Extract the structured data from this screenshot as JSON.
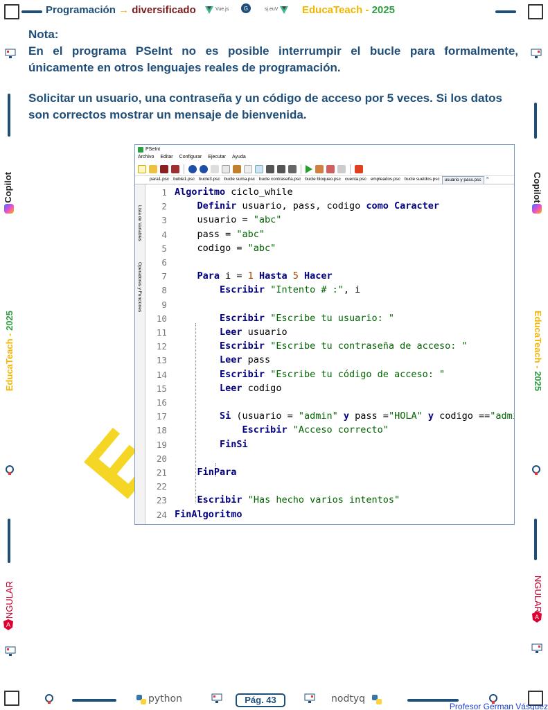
{
  "header": {
    "left_text": "Programación",
    "arrow": "→",
    "right_text": "diversificado",
    "vue_text": "Vue.js",
    "vue_mirror_text": "sį.euV",
    "brand_a": "EducaTeach - ",
    "brand_b": "2025"
  },
  "note": {
    "title": "Nota:",
    "text": "En el programa PSeInt no es posible interrumpir el bucle para formalmente, únicamente en otros lenguajes reales de programación."
  },
  "task": {
    "text": "Solicitar un usuario, una contraseña y un código de acceso por 5 veces. Si los datos son correctos mostrar un mensaje de bienvenida."
  },
  "side": {
    "copilot": "Copilot",
    "brand": "EducaTeach - ",
    "brand_year": "2025",
    "angular": "NGULAR"
  },
  "pseint": {
    "title": "PSeInt",
    "menu": [
      "Archivo",
      "Editar",
      "Configurar",
      "Ejecutar",
      "Ayuda"
    ],
    "tabs": [
      "para1.psc",
      "buble1.psc",
      "bucle3.psc",
      "bucle suma.psc",
      "bucle contraseña.psc",
      "bucle bloqueo.psc",
      "cuenta.psc",
      "empleados.psc",
      "bucle sueldos.psc",
      "usuario y pass.psc"
    ],
    "tab_close": "×",
    "side_tabs": [
      "Lista de Variables",
      "Operadores y Funciones"
    ],
    "code": [
      {
        "n": "1",
        "parts": [
          {
            "t": "kw",
            "v": "Algoritmo"
          },
          {
            "t": "pl",
            "v": " ciclo_while"
          }
        ]
      },
      {
        "n": "2",
        "parts": [
          {
            "t": "pl",
            "v": "    "
          },
          {
            "t": "kw",
            "v": "Definir"
          },
          {
            "t": "pl",
            "v": " usuario, pass, codigo "
          },
          {
            "t": "kw",
            "v": "como"
          },
          {
            "t": "pl",
            "v": " "
          },
          {
            "t": "kw",
            "v": "Caracter"
          }
        ]
      },
      {
        "n": "3",
        "parts": [
          {
            "t": "pl",
            "v": "    usuario = "
          },
          {
            "t": "str",
            "v": "\"abc\""
          }
        ]
      },
      {
        "n": "4",
        "parts": [
          {
            "t": "pl",
            "v": "    pass = "
          },
          {
            "t": "str",
            "v": "\"abc\""
          }
        ]
      },
      {
        "n": "5",
        "parts": [
          {
            "t": "pl",
            "v": "    codigo = "
          },
          {
            "t": "str",
            "v": "\"abc\""
          }
        ]
      },
      {
        "n": "6",
        "parts": []
      },
      {
        "n": "7",
        "parts": [
          {
            "t": "pl",
            "v": "    "
          },
          {
            "t": "kw",
            "v": "Para"
          },
          {
            "t": "pl",
            "v": " i = "
          },
          {
            "t": "num",
            "v": "1"
          },
          {
            "t": "pl",
            "v": " "
          },
          {
            "t": "kw",
            "v": "Hasta"
          },
          {
            "t": "pl",
            "v": " "
          },
          {
            "t": "num",
            "v": "5"
          },
          {
            "t": "pl",
            "v": " "
          },
          {
            "t": "kw",
            "v": "Hacer"
          }
        ]
      },
      {
        "n": "8",
        "parts": [
          {
            "t": "pl",
            "v": "        "
          },
          {
            "t": "kw",
            "v": "Escribir"
          },
          {
            "t": "pl",
            "v": " "
          },
          {
            "t": "str",
            "v": "\"Intento # :\""
          },
          {
            "t": "pl",
            "v": ", i"
          }
        ]
      },
      {
        "n": "9",
        "parts": []
      },
      {
        "n": "10",
        "parts": [
          {
            "t": "pl",
            "v": "        "
          },
          {
            "t": "kw",
            "v": "Escribir"
          },
          {
            "t": "pl",
            "v": " "
          },
          {
            "t": "str",
            "v": "\"Escribe tu usuario: \""
          }
        ]
      },
      {
        "n": "11",
        "parts": [
          {
            "t": "pl",
            "v": "        "
          },
          {
            "t": "kw",
            "v": "Leer"
          },
          {
            "t": "pl",
            "v": " usuario"
          }
        ]
      },
      {
        "n": "12",
        "parts": [
          {
            "t": "pl",
            "v": "        "
          },
          {
            "t": "kw",
            "v": "Escribir"
          },
          {
            "t": "pl",
            "v": " "
          },
          {
            "t": "str",
            "v": "\"Escribe tu contraseña de acceso: \""
          }
        ]
      },
      {
        "n": "13",
        "parts": [
          {
            "t": "pl",
            "v": "        "
          },
          {
            "t": "kw",
            "v": "Leer"
          },
          {
            "t": "pl",
            "v": " pass"
          }
        ]
      },
      {
        "n": "14",
        "parts": [
          {
            "t": "pl",
            "v": "        "
          },
          {
            "t": "kw",
            "v": "Escribir"
          },
          {
            "t": "pl",
            "v": " "
          },
          {
            "t": "str",
            "v": "\"Escribe tu código de acceso: \""
          }
        ]
      },
      {
        "n": "15",
        "parts": [
          {
            "t": "pl",
            "v": "        "
          },
          {
            "t": "kw",
            "v": "Leer"
          },
          {
            "t": "pl",
            "v": " codigo"
          }
        ]
      },
      {
        "n": "16",
        "parts": []
      },
      {
        "n": "17",
        "parts": [
          {
            "t": "pl",
            "v": "        "
          },
          {
            "t": "kw",
            "v": "Si"
          },
          {
            "t": "pl",
            "v": " (usuario = "
          },
          {
            "t": "str",
            "v": "\"admin\""
          },
          {
            "t": "pl",
            "v": " "
          },
          {
            "t": "kw",
            "v": "y"
          },
          {
            "t": "pl",
            "v": " pass ="
          },
          {
            "t": "str",
            "v": "\"HOLA\""
          },
          {
            "t": "pl",
            "v": " "
          },
          {
            "t": "kw",
            "v": "y"
          },
          {
            "t": "pl",
            "v": " codigo =="
          },
          {
            "t": "str",
            "v": "\"admin\""
          },
          {
            "t": "pl",
            "v": ")"
          }
        ]
      },
      {
        "n": "18",
        "parts": [
          {
            "t": "pl",
            "v": "            "
          },
          {
            "t": "kw",
            "v": "Escribir"
          },
          {
            "t": "pl",
            "v": " "
          },
          {
            "t": "str",
            "v": "\"Acceso correcto\""
          }
        ]
      },
      {
        "n": "19",
        "parts": [
          {
            "t": "pl",
            "v": "        "
          },
          {
            "t": "kw",
            "v": "FinSi"
          }
        ]
      },
      {
        "n": "20",
        "parts": []
      },
      {
        "n": "21",
        "parts": [
          {
            "t": "pl",
            "v": "    "
          },
          {
            "t": "kw",
            "v": "FinPara"
          }
        ]
      },
      {
        "n": "22",
        "parts": []
      },
      {
        "n": "23",
        "parts": [
          {
            "t": "pl",
            "v": "    "
          },
          {
            "t": "kw",
            "v": "Escribir"
          },
          {
            "t": "pl",
            "v": " "
          },
          {
            "t": "str",
            "v": "\"Has hecho varios intentos\""
          }
        ]
      },
      {
        "n": "24",
        "parts": [
          {
            "t": "kw",
            "v": "FinAlgoritmo"
          }
        ]
      }
    ]
  },
  "watermark": "Ed",
  "footer": {
    "python_left": "python",
    "python_right": "nodtyq",
    "page": "Pág. 43",
    "professor": "Profesor German Vásquez"
  },
  "colors": {
    "primary": "#1f4e79",
    "accent_yellow": "#f5b400",
    "accent_green": "#2e9e42",
    "keyword": "#000080",
    "string": "#006400"
  }
}
